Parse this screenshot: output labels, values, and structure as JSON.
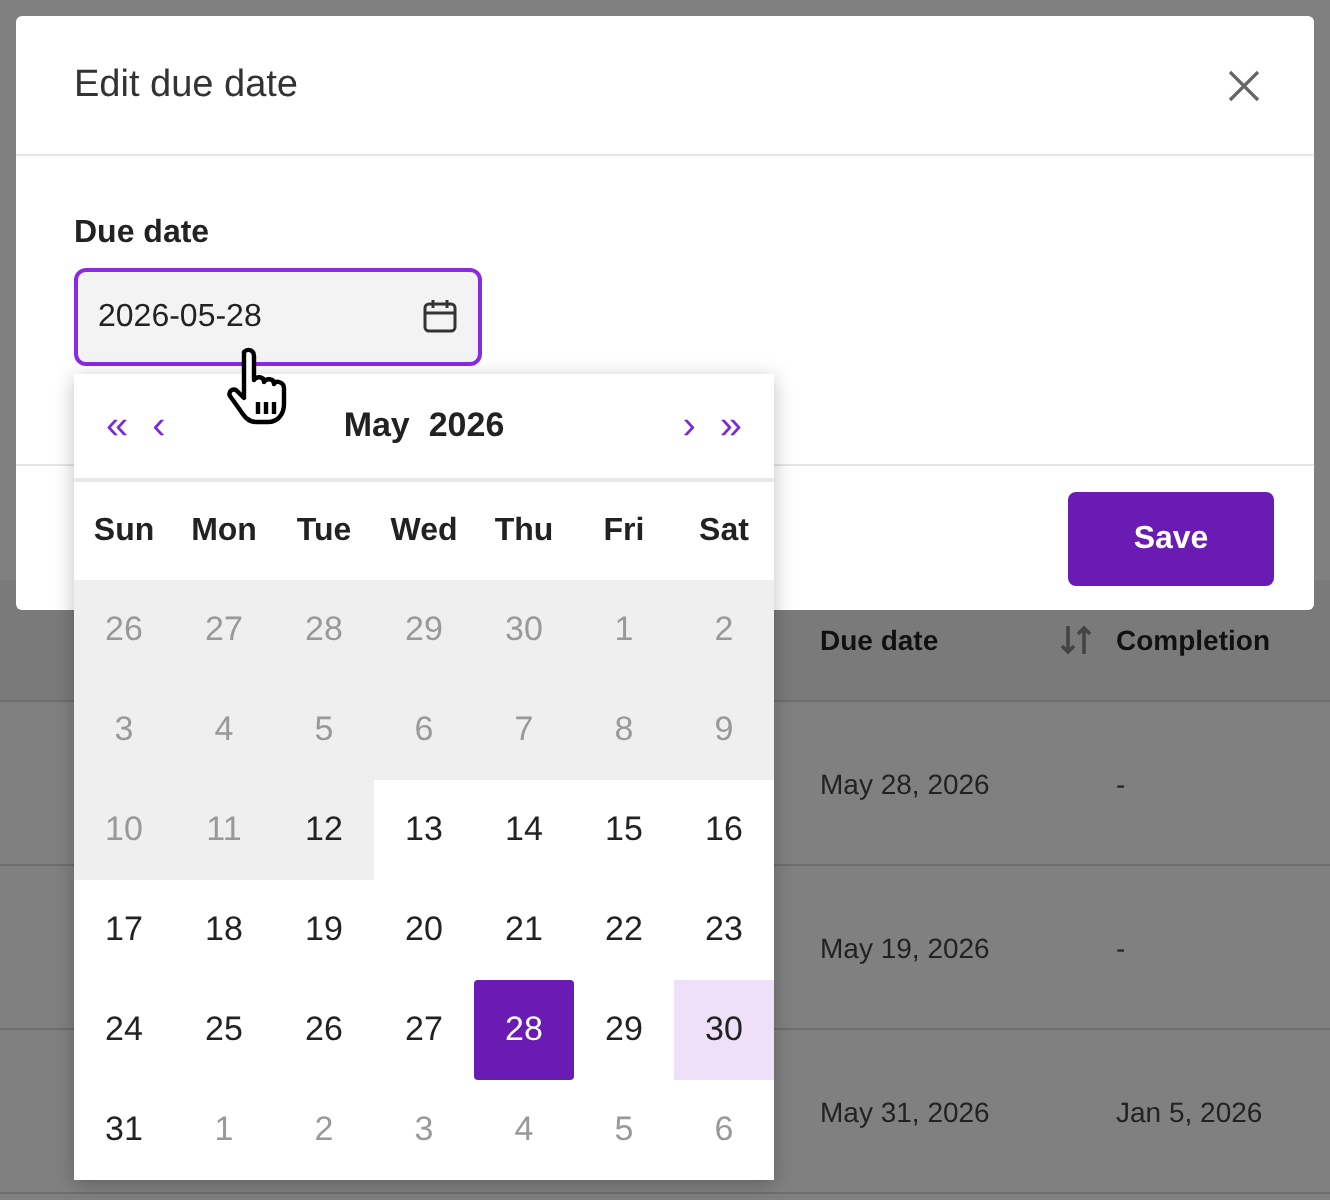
{
  "background": {
    "table": {
      "columns": [
        "Due date",
        "Completion"
      ],
      "rows": [
        [
          "May 28, 2026",
          "-"
        ],
        [
          "May 19, 2026",
          "-"
        ],
        [
          "May 31, 2026",
          "Jan 5, 2026"
        ]
      ]
    }
  },
  "dialog": {
    "title": "Edit due date",
    "field_label": "Due date",
    "value": "2026-05-28",
    "save": "Save"
  },
  "calendar": {
    "month": "May",
    "year": "2026",
    "prev_year": "«",
    "prev_month": "‹",
    "next_month": "›",
    "next_year": "»",
    "weekdays": [
      "Sun",
      "Mon",
      "Tue",
      "Wed",
      "Thu",
      "Fri",
      "Sat"
    ],
    "weeks": [
      [
        {
          "label": "26",
          "muted": true,
          "shaded": true,
          "selected": false,
          "highlighted": false
        },
        {
          "label": "27",
          "muted": true,
          "shaded": true,
          "selected": false,
          "highlighted": false
        },
        {
          "label": "28",
          "muted": true,
          "shaded": true,
          "selected": false,
          "highlighted": false
        },
        {
          "label": "29",
          "muted": true,
          "shaded": true,
          "selected": false,
          "highlighted": false
        },
        {
          "label": "30",
          "muted": true,
          "shaded": true,
          "selected": false,
          "highlighted": false
        },
        {
          "label": "1",
          "muted": true,
          "shaded": true,
          "selected": false,
          "highlighted": false
        },
        {
          "label": "2",
          "muted": true,
          "shaded": true,
          "selected": false,
          "highlighted": false
        }
      ],
      [
        {
          "label": "3",
          "muted": true,
          "shaded": true,
          "selected": false,
          "highlighted": false
        },
        {
          "label": "4",
          "muted": true,
          "shaded": true,
          "selected": false,
          "highlighted": false
        },
        {
          "label": "5",
          "muted": true,
          "shaded": true,
          "selected": false,
          "highlighted": false
        },
        {
          "label": "6",
          "muted": true,
          "shaded": true,
          "selected": false,
          "highlighted": false
        },
        {
          "label": "7",
          "muted": true,
          "shaded": true,
          "selected": false,
          "highlighted": false
        },
        {
          "label": "8",
          "muted": true,
          "shaded": true,
          "selected": false,
          "highlighted": false
        },
        {
          "label": "9",
          "muted": true,
          "shaded": true,
          "selected": false,
          "highlighted": false
        }
      ],
      [
        {
          "label": "10",
          "muted": true,
          "shaded": true,
          "selected": false,
          "highlighted": false
        },
        {
          "label": "11",
          "muted": true,
          "shaded": true,
          "selected": false,
          "highlighted": false
        },
        {
          "label": "12",
          "muted": false,
          "shaded": true,
          "selected": false,
          "highlighted": false
        },
        {
          "label": "13",
          "muted": false,
          "shaded": false,
          "selected": false,
          "highlighted": false
        },
        {
          "label": "14",
          "muted": false,
          "shaded": false,
          "selected": false,
          "highlighted": false
        },
        {
          "label": "15",
          "muted": false,
          "shaded": false,
          "selected": false,
          "highlighted": false
        },
        {
          "label": "16",
          "muted": false,
          "shaded": false,
          "selected": false,
          "highlighted": false
        }
      ],
      [
        {
          "label": "17",
          "muted": false,
          "shaded": false,
          "selected": false,
          "highlighted": false
        },
        {
          "label": "18",
          "muted": false,
          "shaded": false,
          "selected": false,
          "highlighted": false
        },
        {
          "label": "19",
          "muted": false,
          "shaded": false,
          "selected": false,
          "highlighted": false
        },
        {
          "label": "20",
          "muted": false,
          "shaded": false,
          "selected": false,
          "highlighted": false
        },
        {
          "label": "21",
          "muted": false,
          "shaded": false,
          "selected": false,
          "highlighted": false
        },
        {
          "label": "22",
          "muted": false,
          "shaded": false,
          "selected": false,
          "highlighted": false
        },
        {
          "label": "23",
          "muted": false,
          "shaded": false,
          "selected": false,
          "highlighted": false
        }
      ],
      [
        {
          "label": "24",
          "muted": false,
          "shaded": false,
          "selected": false,
          "highlighted": false
        },
        {
          "label": "25",
          "muted": false,
          "shaded": false,
          "selected": false,
          "highlighted": false
        },
        {
          "label": "26",
          "muted": false,
          "shaded": false,
          "selected": false,
          "highlighted": false
        },
        {
          "label": "27",
          "muted": false,
          "shaded": false,
          "selected": false,
          "highlighted": false
        },
        {
          "label": "28",
          "muted": false,
          "shaded": false,
          "selected": true,
          "highlighted": false
        },
        {
          "label": "29",
          "muted": false,
          "shaded": false,
          "selected": false,
          "highlighted": false
        },
        {
          "label": "30",
          "muted": false,
          "shaded": false,
          "selected": false,
          "highlighted": true
        }
      ],
      [
        {
          "label": "31",
          "muted": false,
          "shaded": false,
          "selected": false,
          "highlighted": false
        },
        {
          "label": "1",
          "muted": true,
          "shaded": false,
          "selected": false,
          "highlighted": false
        },
        {
          "label": "2",
          "muted": true,
          "shaded": false,
          "selected": false,
          "highlighted": false
        },
        {
          "label": "3",
          "muted": true,
          "shaded": false,
          "selected": false,
          "highlighted": false
        },
        {
          "label": "4",
          "muted": true,
          "shaded": false,
          "selected": false,
          "highlighted": false
        },
        {
          "label": "5",
          "muted": true,
          "shaded": false,
          "selected": false,
          "highlighted": false
        },
        {
          "label": "6",
          "muted": true,
          "shaded": false,
          "selected": false,
          "highlighted": false
        }
      ]
    ]
  }
}
